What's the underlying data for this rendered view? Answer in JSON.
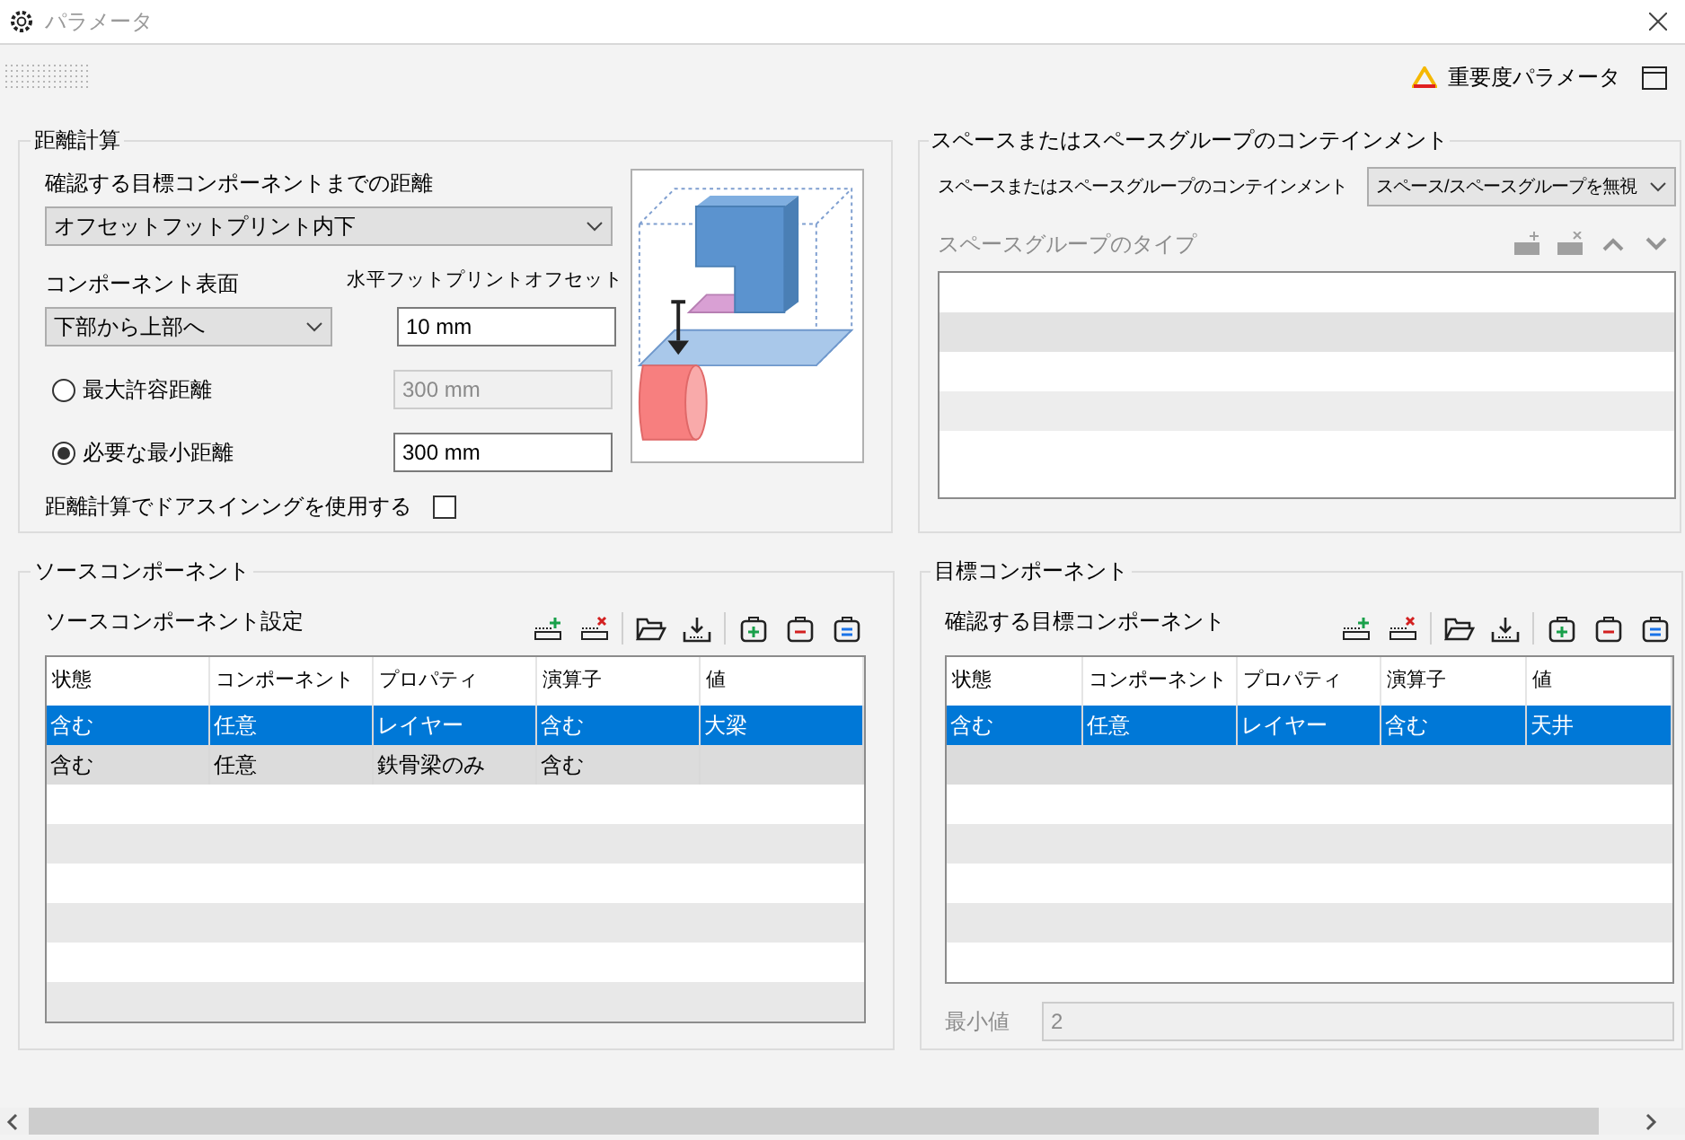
{
  "window": {
    "title": "パラメータ"
  },
  "toolbar": {
    "importance_label": "重要度パラメータ"
  },
  "distance": {
    "legend": "距離計算",
    "target_label": "確認する目標コンポーネントまでの距離",
    "target_value": "オフセットフットプリント内下",
    "surface_label": "コンポーネント表面",
    "surface_value": "下部から上部へ",
    "offset_label": "水平フットプリントオフセット",
    "offset_value": "10 mm",
    "options": [
      {
        "label": "最大許容距離",
        "selected": false,
        "value": "300 mm",
        "disabled": true
      },
      {
        "label": "必要な最小距離",
        "selected": true,
        "value": "300 mm",
        "disabled": false
      }
    ],
    "ducting_label": "距離計算でドアスインングを使用する",
    "ducting_checked": false
  },
  "containment": {
    "legend": "スペースまたはスペースグループのコンテインメント",
    "label": "スペースまたはスペースグループのコンテインメント",
    "value": "スペース/スペースグループを無視",
    "types_label": "スペースグループのタイプ",
    "types_disabled": true
  },
  "source": {
    "legend": "ソースコンポーネント",
    "subtitle": "ソースコンポーネント設定",
    "columns": [
      "状態",
      "コンポーネント",
      "プロパティ",
      "演算子",
      "値"
    ],
    "rows": [
      {
        "cells": [
          "含む",
          "任意",
          "レイヤー",
          "含む",
          "大梁"
        ],
        "selected": true
      },
      {
        "cells": [
          "含む",
          "任意",
          "鉄骨梁のみ",
          "含む",
          ""
        ],
        "selected": false
      }
    ]
  },
  "target": {
    "legend": "目標コンポーネント",
    "subtitle": "確認する目標コンポーネント",
    "columns": [
      "状態",
      "コンポーネント",
      "プロパティ",
      "演算子",
      "値"
    ],
    "rows": [
      {
        "cells": [
          "含む",
          "任意",
          "レイヤー",
          "含む",
          "天井"
        ],
        "selected": true
      }
    ],
    "min_label": "最小値",
    "min_value": "2",
    "min_disabled": true
  }
}
